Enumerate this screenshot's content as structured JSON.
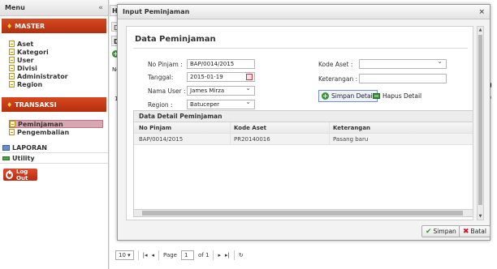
{
  "sidebar": {
    "title": "Menu",
    "collapse": "«",
    "master": {
      "label": "MASTER",
      "items": [
        {
          "label": "Aset"
        },
        {
          "label": "Kategori"
        },
        {
          "label": "User"
        },
        {
          "label": "Divisi"
        },
        {
          "label": "Administrator"
        },
        {
          "label": "Region"
        }
      ]
    },
    "transaksi": {
      "label": "TRANSAKSI",
      "items": [
        {
          "label": "Peminjaman"
        },
        {
          "label": "Pengembalian"
        }
      ]
    },
    "laporan": "LAPORAN",
    "utility": "Utility",
    "logout": "Log Out"
  },
  "background": {
    "tab1": "Hor",
    "tab2": "Da",
    "tab3": "Dat",
    "col_no": "No",
    "row_1": "1",
    "right_g": "g",
    "right_ra": "ra",
    "pager": {
      "page_size": "10 ▾",
      "first": "|◂",
      "prev": "◂",
      "page_label": "Page",
      "page_value": "1",
      "of_label": "of 1",
      "next": "▸",
      "last": "▸|",
      "refresh": "↻"
    }
  },
  "modal": {
    "title": "Input Peminjaman",
    "close": "×",
    "section_title": "Data Peminjaman",
    "form": {
      "no_pinjam_label": "No Pinjam :",
      "no_pinjam_value": "BAP/0014/2015",
      "tanggal_label": "Tanggal:",
      "tanggal_value": "2015-01-19",
      "nama_user_label": "Nama User :",
      "nama_user_value": "James Mirza",
      "region_label": "Region :",
      "region_value": "Batuceper",
      "kode_aset_label": "Kode Aset :",
      "kode_aset_value": "",
      "keterangan_label": "Keterangan :",
      "keterangan_value": ""
    },
    "simpan_detail": "Simpan Detail",
    "hapus_detail": "Hapus Detail",
    "detail": {
      "title": "Data Detail Peminjaman",
      "columns": [
        "No Pinjam",
        "Kode Aset",
        "Keterangan"
      ],
      "rows": [
        [
          "BAP/0014/2015",
          "PR20140016",
          "Pasang baru"
        ]
      ]
    },
    "save": "Simpan",
    "cancel": "Batal"
  }
}
